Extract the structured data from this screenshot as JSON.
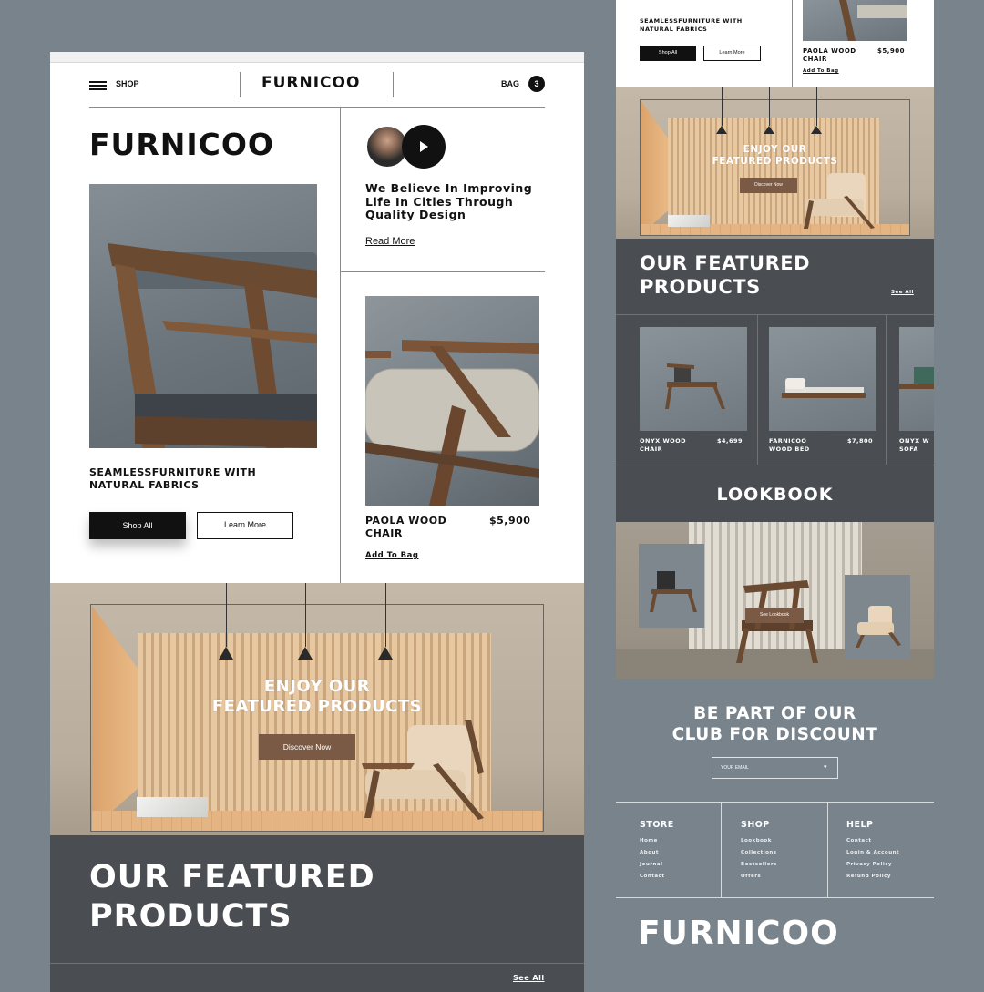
{
  "left_page": {
    "nav": {
      "shop_label": "SHOP",
      "logo": "FURNICOO",
      "bag_label": "BAG",
      "bag_count": "3"
    },
    "hero": {
      "brand": "FURNICOO",
      "tagline": "SEAMLESSFURNITURE WITH NATURAL FABRICS",
      "shop_all": "Shop All",
      "learn_more": "Learn More",
      "believe": "We Believe In Improving Life In Cities Through Quality Design",
      "read_more": "Read More"
    },
    "product": {
      "name": "PAOLA WOOD CHAIR",
      "price": "$5,900",
      "add_to_bag": "Add To Bag"
    },
    "banner": {
      "title_line1": "ENJOY OUR",
      "title_line2": "FEATURED PRODUCTS",
      "button": "Discover Now"
    },
    "featured": {
      "title_line1": "OUR FEATURED",
      "title_line2": "PRODUCTS",
      "see_all": "See All"
    }
  },
  "right_page": {
    "top": {
      "tagline": "SEAMLESSFURNITURE WITH NATURAL FABRICS",
      "shop_all": "Shop All",
      "learn_more": "Learn More",
      "product_name": "PAOLA WOOD CHAIR",
      "product_price": "$5,900",
      "add_to_bag": "Add To Bag"
    },
    "banner": {
      "title_line1": "ENJOY OUR",
      "title_line2": "FEATURED PRODUCTS",
      "button": "Discover Now"
    },
    "featured": {
      "title_line1": "OUR FEATURED",
      "title_line2": "PRODUCTS",
      "see_all": "See All",
      "items": [
        {
          "name_line1": "ONYX WOOD",
          "name_line2": "CHAIR",
          "price": "$4,699"
        },
        {
          "name_line1": "FARNICOO",
          "name_line2": "WOOD BED",
          "price": "$7,800"
        },
        {
          "name_line1": "ONYX W",
          "name_line2": "SOFA",
          "price": ""
        }
      ]
    },
    "lookbook": {
      "title": "LOOKBOOK",
      "button": "See Lookbook"
    },
    "club": {
      "title_line1": "BE PART OF OUR",
      "title_line2": "CLUB FOR DISCOUNT",
      "email_placeholder": "YOUR EMAIL"
    },
    "footer": {
      "columns": [
        {
          "title": "STORE",
          "links": [
            "Home",
            "About",
            "Journal",
            "Contact"
          ]
        },
        {
          "title": "SHOP",
          "links": [
            "Lookbook",
            "Collections",
            "Bestsellers",
            "Offers"
          ]
        },
        {
          "title": "HELP",
          "links": [
            "Contact",
            "Login & Account",
            "Privacy Policy",
            "Refund Policy"
          ]
        }
      ],
      "brand": "FURNICOO"
    }
  },
  "colors": {
    "background": "#78838b",
    "dark_band": "#4a4e52",
    "button_brown": "#7a5a44",
    "black": "#111111"
  }
}
